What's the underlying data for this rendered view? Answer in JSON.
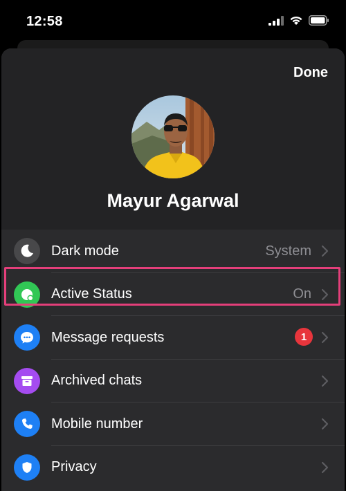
{
  "status_bar": {
    "time": "12:58"
  },
  "header": {
    "done_label": "Done"
  },
  "profile": {
    "name": "Mayur Agarwal"
  },
  "settings": [
    {
      "label": "Dark mode",
      "value": "System",
      "icon": "moon-icon",
      "icon_color": "#48484a"
    },
    {
      "label": "Active Status",
      "value": "On",
      "icon": "active-status-icon",
      "icon_color": "#31c755"
    },
    {
      "label": "Message requests",
      "badge": "1",
      "icon": "message-bubble-icon",
      "icon_color": "#1e80f5",
      "highlighted": true
    },
    {
      "label": "Archived chats",
      "icon": "archive-box-icon",
      "icon_color": "#a54cf0"
    },
    {
      "label": "Mobile number",
      "icon": "phone-icon",
      "icon_color": "#1e80f5"
    },
    {
      "label": "Privacy",
      "icon": "shield-icon",
      "icon_color": "#1e80f5"
    }
  ],
  "colors": {
    "highlight_border": "#e43f7a",
    "badge": "#e8353c",
    "secondary_text": "#8e8e93"
  }
}
